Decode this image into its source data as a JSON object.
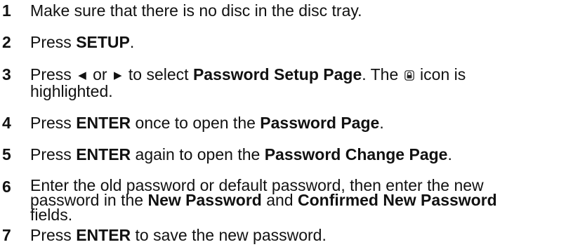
{
  "steps": [
    {
      "number": "1",
      "segments": [
        {
          "text": "Make sure that there is no disc in the disc tray.",
          "bold": false
        }
      ]
    },
    {
      "number": "2",
      "segments": [
        {
          "text": "Press ",
          "bold": false
        },
        {
          "text": "SETUP",
          "bold": true
        },
        {
          "text": ".",
          "bold": false
        }
      ]
    },
    {
      "number": "3",
      "lines": [
        {
          "segments_a": {
            "press": "Press ",
            "left_arrow_icon": "triangle-left",
            "or": " or ",
            "right_arrow_icon": "triangle-right",
            "to_select": " to select "
          },
          "bold_1": "Password Setup Page",
          "the": ". The ",
          "icon_name": "lock-icon",
          "icon_is": " icon is"
        },
        {
          "text": "highlighted."
        }
      ]
    },
    {
      "number": "4",
      "segments": [
        {
          "text": "Press ",
          "bold": false
        },
        {
          "text": "ENTER",
          "bold": true
        },
        {
          "text": " once to open the ",
          "bold": false
        },
        {
          "text": "Password Page",
          "bold": true
        },
        {
          "text": ".",
          "bold": false
        }
      ]
    },
    {
      "number": "5",
      "segments": [
        {
          "text": "Press ",
          "bold": false
        },
        {
          "text": "ENTER",
          "bold": true
        },
        {
          "text": " again to open the ",
          "bold": false
        },
        {
          "text": "Password Change Page",
          "bold": true
        },
        {
          "text": ".",
          "bold": false
        }
      ]
    },
    {
      "number": "6",
      "lines": [
        {
          "text": "Enter the old password or default password, then enter the new"
        },
        {
          "pre": "password in the ",
          "bold_1": "New Password",
          "mid": " and ",
          "bold_2": "Confirmed New Password"
        },
        {
          "text": "fields."
        }
      ]
    },
    {
      "number": "7",
      "segments": [
        {
          "text": "Press ",
          "bold": false
        },
        {
          "text": "ENTER",
          "bold": true
        },
        {
          "text": " to save the new password.",
          "bold": false
        }
      ]
    }
  ]
}
